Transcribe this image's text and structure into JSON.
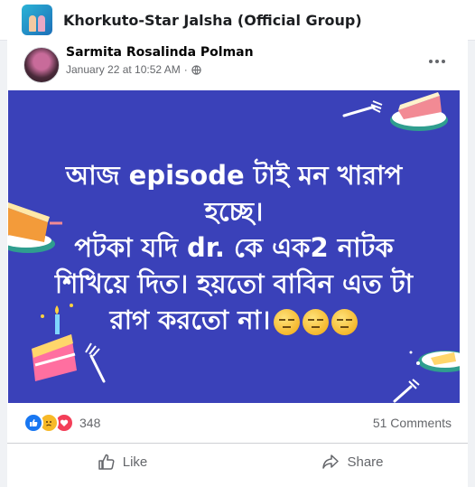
{
  "group": {
    "name": "Khorkuto-Star Jalsha (Official Group)"
  },
  "post": {
    "author": "Sarmita Rosalinda Polman",
    "timestamp": "January 22 at 10:52 AM",
    "separator": "·",
    "privacy_icon": "globe-icon",
    "image_text_lines": [
      "আজ episode টাই মন খারাপ",
      "হচ্ছে।",
      "পটকা যদি dr. কে এক2 নাটক",
      "শিখিয়ে দিত। হয়তো বাবিন এত টা",
      "রাগ করতো না।"
    ],
    "emojis": [
      "expressionless-face",
      "expressionless-face",
      "expressionless-face"
    ],
    "image_background": "#3a41b9"
  },
  "stats": {
    "reaction_icons": [
      "like-icon",
      "sad-icon",
      "love-icon"
    ],
    "reaction_count": "348",
    "comments": "51 Comments"
  },
  "actions": {
    "like_label": "Like",
    "share_label": "Share"
  }
}
